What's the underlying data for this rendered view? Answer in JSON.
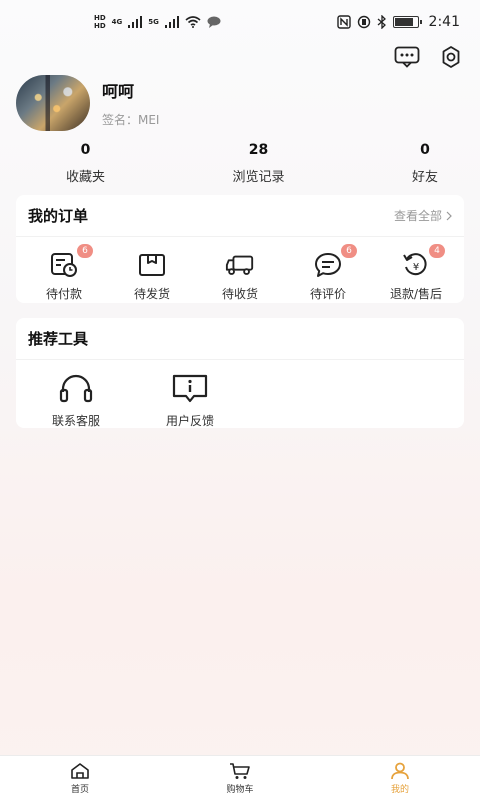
{
  "status_bar": {
    "left_tags": [
      "HD",
      "HD"
    ],
    "network_labels": [
      "4G",
      "5G"
    ],
    "time": "2:41"
  },
  "header": {
    "icons": [
      "message-icon",
      "settings-icon"
    ]
  },
  "profile": {
    "nickname": "呵呵",
    "signature": "签名：MEI"
  },
  "stats": [
    {
      "value": "0",
      "label": "收藏夹"
    },
    {
      "value": "28",
      "label": "浏览记录"
    },
    {
      "value": "0",
      "label": "好友"
    }
  ],
  "orders": {
    "title": "我的订单",
    "view_all": "查看全部",
    "items": [
      {
        "label": "待付款",
        "badge": "6",
        "icon": "pending-payment-icon"
      },
      {
        "label": "待发货",
        "badge": "",
        "icon": "package-icon"
      },
      {
        "label": "待收货",
        "badge": "",
        "icon": "truck-icon"
      },
      {
        "label": "待评价",
        "badge": "6",
        "icon": "review-icon"
      },
      {
        "label": "退款/售后",
        "badge": "4",
        "icon": "refund-icon"
      }
    ]
  },
  "tools": {
    "title": "推荐工具",
    "items": [
      {
        "label": "联系客服",
        "icon": "headset-icon"
      },
      {
        "label": "用户反馈",
        "icon": "feedback-icon"
      }
    ]
  },
  "tab_bar": {
    "tabs": [
      {
        "label": "首页",
        "icon": "home-icon",
        "active": false
      },
      {
        "label": "购物车",
        "icon": "cart-icon",
        "active": false
      },
      {
        "label": "我的",
        "icon": "user-icon",
        "active": true
      }
    ],
    "active_color": "#e6a23c"
  },
  "colors": {
    "badge": "#f08e84",
    "accent": "#e6a23c"
  }
}
